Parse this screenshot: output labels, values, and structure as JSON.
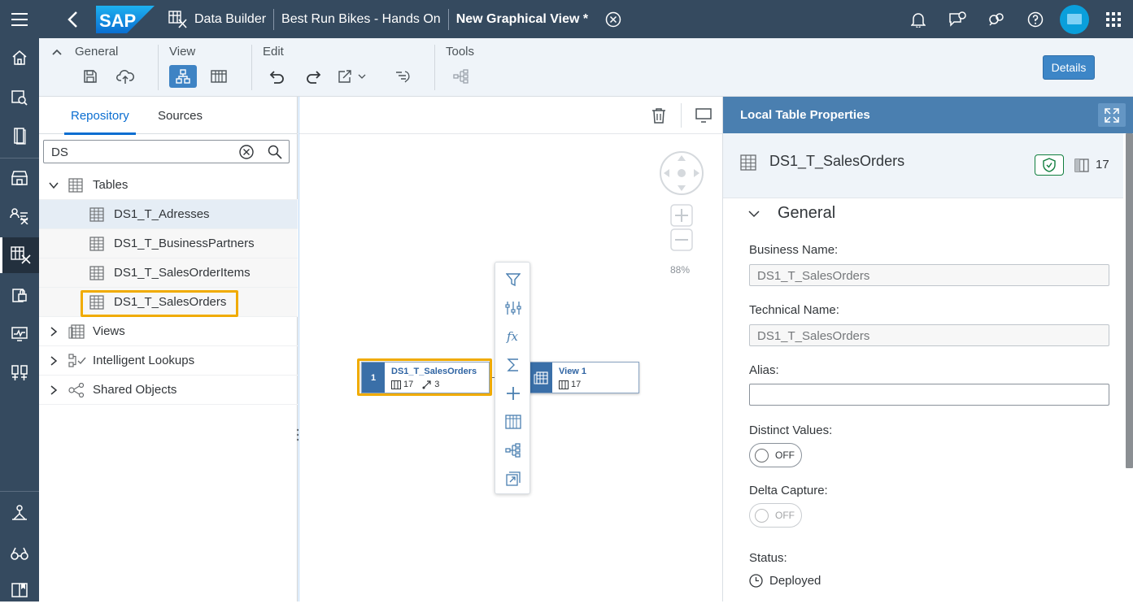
{
  "shell": {
    "brand": "SAP",
    "breadcrumbs": [
      {
        "label": "Data Builder"
      },
      {
        "label": "Best Run Bikes - Hands On"
      },
      {
        "label": "New Graphical View *"
      }
    ],
    "icons": [
      "menu-icon",
      "back-icon",
      "data-builder-icon",
      "close-tab-icon",
      "notification-icon",
      "feedback-icon",
      "support-icon",
      "help-icon",
      "user-avatar",
      "product-switch-icon"
    ]
  },
  "leftnav": {
    "items": [
      "home-icon",
      "data-marketplace-icon",
      "repository-icon",
      "catalog-icon",
      "business-builder-icon",
      "data-builder-icon",
      "security-icon",
      "monitor-icon",
      "space-management-icon",
      "data-integration-icon",
      "view-glasses-icon",
      "documentation-icon"
    ]
  },
  "toolbar": {
    "groups": {
      "general": "General",
      "view": "View",
      "edit": "Edit",
      "tools": "Tools"
    },
    "details_label": "Details"
  },
  "repository": {
    "tabs": [
      "Repository",
      "Sources"
    ],
    "search": {
      "value": "DS"
    },
    "tree": {
      "tables_label": "Tables",
      "tables": [
        "DS1_T_Adresses",
        "DS1_T_BusinessPartners",
        "DS1_T_SalesOrderItems",
        "DS1_T_SalesOrders"
      ],
      "views_label": "Views",
      "lookups_label": "Intelligent Lookups",
      "shared_label": "Shared Objects"
    }
  },
  "canvas": {
    "zoom_label": "88%",
    "nodes": [
      {
        "index": "1",
        "name": "DS1_T_SalesOrders",
        "columns": "17",
        "associations": "3"
      },
      {
        "name": "View 1",
        "columns": "17"
      }
    ],
    "context_menu": [
      "filter-icon",
      "projection-icon",
      "calculated-column-icon",
      "aggregation-icon",
      "add-icon",
      "join-icon",
      "union-icon",
      "expand-icon"
    ]
  },
  "properties": {
    "panel_title": "Local Table Properties",
    "object_name": "DS1_T_SalesOrders",
    "column_count": "17",
    "section": "General",
    "business_name_label": "Business Name:",
    "business_name": "DS1_T_SalesOrders",
    "technical_name_label": "Technical Name:",
    "technical_name": "DS1_T_SalesOrders",
    "alias_label": "Alias:",
    "alias": "",
    "distinct_label": "Distinct Values:",
    "distinct_state": "OFF",
    "delta_label": "Delta Capture:",
    "delta_state": "OFF",
    "status_label": "Status:",
    "status": "Deployed"
  },
  "colors": {
    "shell": "#354a5f",
    "accent": "#0a6ed1",
    "highlight": "#f0ab00",
    "panel_header": "#4a7fb0"
  }
}
